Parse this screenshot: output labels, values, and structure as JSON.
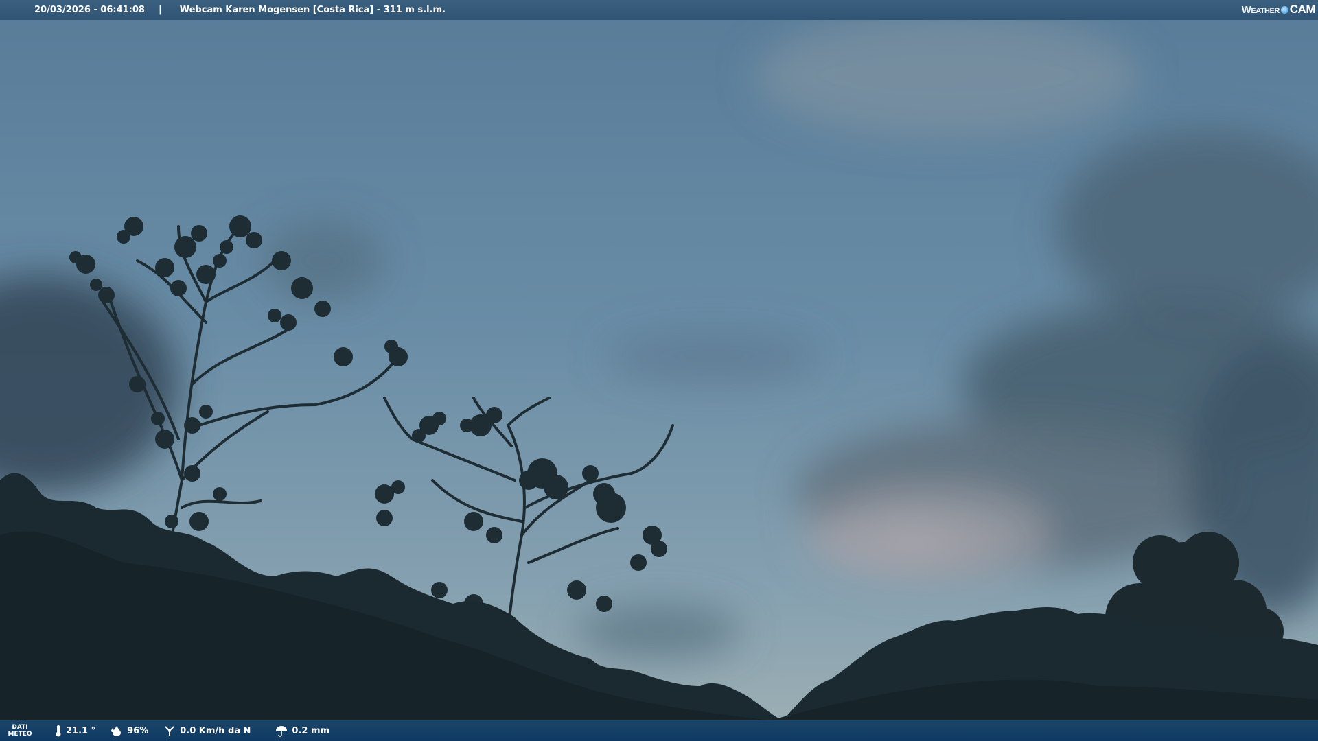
{
  "header": {
    "datetime": "20/03/2026 - 06:41:08",
    "separator": "|",
    "camera": "Webcam Karen Mogensen [Costa Rica]  - 311 m s.l.m.",
    "brand_weather": "Weather",
    "brand_cam": "CAM"
  },
  "footer": {
    "dati_line1": "DATI",
    "dati_line2": "METEO",
    "temperature": "21.1 °",
    "humidity": "96%",
    "wind": "0.0 Km/h da N",
    "rain": "0.2 mm"
  },
  "icons": {
    "temperature": "thermometer-icon",
    "humidity": "humidity-drop-icon",
    "wind": "wind-icon",
    "rain": "umbrella-icon",
    "brand_dot": "globe-icon"
  },
  "colors": {
    "sky_top": "#5b7f9c",
    "sky_mid": "#6c8fa8",
    "sky_low": "#93a9b3",
    "cloud_dark": "#3f5566",
    "silhouette": "#1c2a30",
    "topbar": "#34597a",
    "bottombar": "#0f3a63"
  }
}
